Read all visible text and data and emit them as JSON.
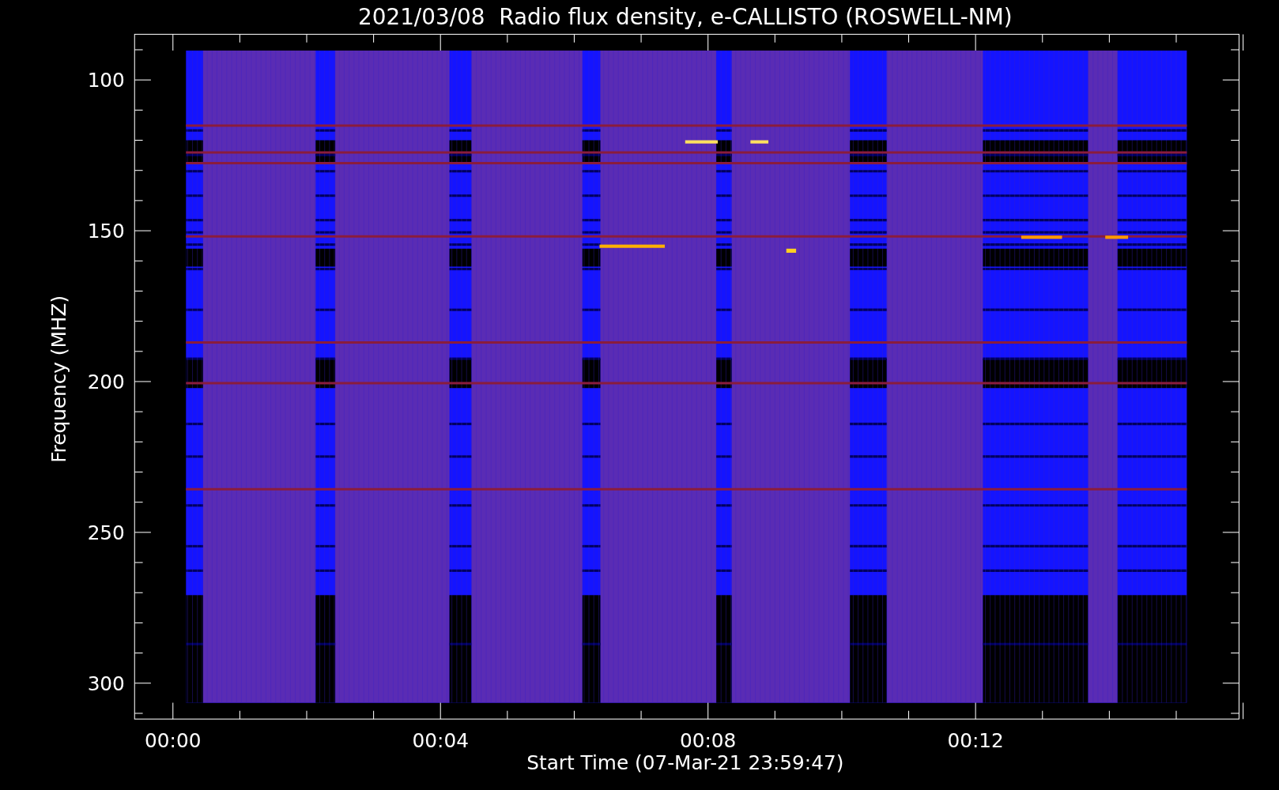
{
  "title": "2021/03/08  Radio flux density, e-CALLISTO (ROSWELL-NM)",
  "y_axis": {
    "label": "Frequency (MHZ)",
    "ticks": [
      "100",
      "150",
      "200",
      "250",
      "300"
    ]
  },
  "x_axis": {
    "label": "Start Time (07-Mar-21 23:59:47)",
    "ticks": [
      "00:00",
      "00:04",
      "00:08",
      "00:12"
    ]
  }
}
